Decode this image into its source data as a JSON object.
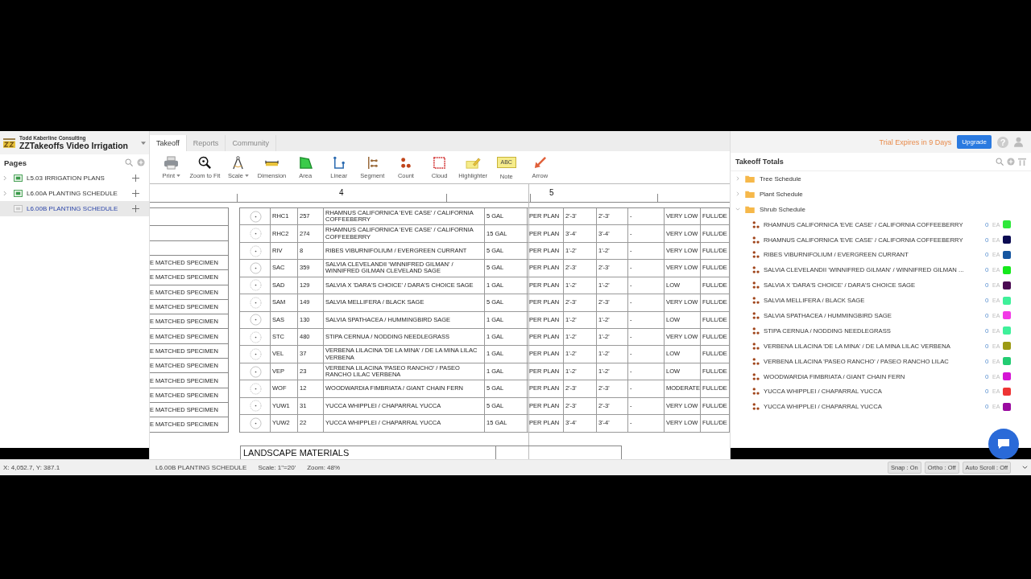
{
  "app": {
    "company": "Todd Kaberline Consulting",
    "project": "ZZTakeoffs Video Irrigation"
  },
  "pages": {
    "title": "Pages",
    "items": [
      {
        "label": "L5.03 IRRIGATION PLANS",
        "selected": false
      },
      {
        "label": "L6.00A PLANTING SCHEDULE",
        "selected": false
      },
      {
        "label": "L6.00B PLANTING SCHEDULE",
        "selected": true
      }
    ]
  },
  "tabs": [
    {
      "label": "Takeoff",
      "selected": true
    },
    {
      "label": "Reports",
      "selected": false
    },
    {
      "label": "Community",
      "selected": false
    }
  ],
  "toolbar": [
    {
      "label": "Print",
      "kind": "print",
      "dropdown": true
    },
    {
      "label": "Zoom to Fit",
      "kind": "zoom",
      "dropdown": false
    },
    {
      "label": "Scale",
      "kind": "scale",
      "dropdown": true
    },
    {
      "label": "Dimension",
      "kind": "dimension",
      "dropdown": false
    },
    {
      "label": "Area",
      "kind": "area",
      "dropdown": false
    },
    {
      "label": "Linear",
      "kind": "linear",
      "dropdown": false
    },
    {
      "label": "Segment",
      "kind": "segment",
      "dropdown": false
    },
    {
      "label": "Count",
      "kind": "count",
      "dropdown": false
    },
    {
      "label": "Cloud",
      "kind": "cloud",
      "dropdown": false
    },
    {
      "label": "Highlighter",
      "kind": "highlighter",
      "dropdown": false
    },
    {
      "label": "Note",
      "kind": "note",
      "dropdown": false,
      "icon_text": "ABC"
    },
    {
      "label": "Arrow",
      "kind": "arrow",
      "dropdown": false
    }
  ],
  "drawing": {
    "grid_labels": [
      "4",
      "5"
    ],
    "left_column": [
      "E MATCHED SPECIMEN",
      "E MATCHED SPECIMEN",
      "E MATCHED SPECIMEN",
      "E MATCHED SPECIMEN",
      "E MATCHED SPECIMEN",
      "E MATCHED SPECIMEN",
      "E MATCHED SPECIMEN",
      "E MATCHED SPECIMEN",
      "E MATCHED SPECIMEN",
      "E MATCHED SPECIMEN",
      "E MATCHED SPECIMEN",
      "E MATCHED SPECIMEN"
    ],
    "schedule_rows": [
      [
        "RHC1",
        "257",
        "RHAMNUS CALIFORNICA 'EVE CASE' / CALIFORNIA COFFEEBERRY",
        "5 GAL",
        "PER PLAN",
        "2'-3'",
        "2'-3'",
        "-",
        "VERY LOW",
        "FULL/DE"
      ],
      [
        "RHC2",
        "274",
        "RHAMNUS CALIFORNICA 'EVE CASE' / CALIFORNIA COFFEEBERRY",
        "15 GAL",
        "PER PLAN",
        "3'-4'",
        "3'-4'",
        "-",
        "VERY LOW",
        "FULL/DE"
      ],
      [
        "RIV",
        "8",
        "RIBES VIBURNIFOLIUM / EVERGREEN CURRANT",
        "5 GAL",
        "PER PLAN",
        "1'-2'",
        "1'-2'",
        "-",
        "VERY LOW",
        "FULL/DE"
      ],
      [
        "SAC",
        "359",
        "SALVIA CLEVELANDII 'WINNIFRED GILMAN' / WINNIFRED GILMAN CLEVELAND SAGE",
        "5 GAL",
        "PER PLAN",
        "2'-3'",
        "2'-3'",
        "-",
        "VERY LOW",
        "FULL/DE"
      ],
      [
        "SAD",
        "129",
        "SALVIA X 'DARA'S CHOICE' / DARA'S CHOICE SAGE",
        "1 GAL",
        "PER PLAN",
        "1'-2'",
        "1'-2'",
        "-",
        "LOW",
        "FULL/DE"
      ],
      [
        "SAM",
        "149",
        "SALVIA MELLIFERA / BLACK SAGE",
        "5 GAL",
        "PER PLAN",
        "2'-3'",
        "2'-3'",
        "-",
        "VERY LOW",
        "FULL/DE"
      ],
      [
        "SAS",
        "130",
        "SALVIA SPATHACEA / HUMMINGBIRD SAGE",
        "1 GAL",
        "PER PLAN",
        "1'-2'",
        "1'-2'",
        "-",
        "LOW",
        "FULL/DE"
      ],
      [
        "STC",
        "480",
        "STIPA CERNUA / NODDING NEEDLEGRASS",
        "1 GAL",
        "PER PLAN",
        "1'-2'",
        "1'-2'",
        "-",
        "VERY LOW",
        "FULL/DE"
      ],
      [
        "VEL",
        "37",
        "VERBENA LILACINA 'DE LA MINA' / DE LA MINA LILAC VERBENA",
        "1 GAL",
        "PER PLAN",
        "1'-2'",
        "1'-2'",
        "-",
        "LOW",
        "FULL/DE"
      ],
      [
        "VEP",
        "23",
        "VERBENA LILACINA 'PASEO RANCHO' / PASEO RANCHO LILAC VERBENA",
        "1 GAL",
        "PER PLAN",
        "1'-2'",
        "1'-2'",
        "-",
        "LOW",
        "FULL/DE"
      ],
      [
        "WOF",
        "12",
        "WOODWARDIA FIMBRIATA / GIANT CHAIN FERN",
        "5 GAL",
        "PER PLAN",
        "2'-3'",
        "2'-3'",
        "-",
        "MODERATE",
        "FULL/DE"
      ],
      [
        "YUW1",
        "31",
        "YUCCA WHIPPLEI / CHAPARRAL YUCCA",
        "5 GAL",
        "PER PLAN",
        "2'-3'",
        "2'-3'",
        "-",
        "VERY LOW",
        "FULL/DE"
      ],
      [
        "YUW2",
        "22",
        "YUCCA WHIPPLEI / CHAPARRAL YUCCA",
        "15 GAL",
        "PER PLAN",
        "3'-4'",
        "3'-4'",
        "-",
        "VERY LOW",
        "FULL/DE"
      ]
    ],
    "materials_title": "LANDSCAPE MATERIALS"
  },
  "top_bar": {
    "trial": "Trial Expires in 9 Days",
    "upgrade": "Upgrade",
    "help": "?"
  },
  "totals": {
    "title": "Takeoff Totals",
    "folders": [
      {
        "label": "Tree Schedule",
        "expanded": false
      },
      {
        "label": "Plant Schedule",
        "expanded": false
      },
      {
        "label": "Shrub Schedule",
        "expanded": true,
        "children": [
          {
            "name": "RHAMNUS CALIFORNICA 'EVE CASE' / CALIFORNIA COFFEEBERRY",
            "count": "0",
            "unit": "EA",
            "color": "#2ee83a"
          },
          {
            "name": "RHAMNUS CALIFORNICA 'EVE CASE' / CALIFORNIA COFFEEBERRY",
            "count": "0",
            "unit": "EA",
            "color": "#0b0b52"
          },
          {
            "name": "RIBES VIBURNIFOLIUM / EVERGREEN CURRANT",
            "count": "0",
            "unit": "EA",
            "color": "#1555a0"
          },
          {
            "name": "SALVIA CLEVELANDII 'WINNIFRED GILMAN' / WINNIFRED GILMAN ...",
            "count": "0",
            "unit": "EA",
            "color": "#14e81c"
          },
          {
            "name": "SALVIA X 'DARA'S CHOICE' / DARA'S CHOICE SAGE",
            "count": "0",
            "unit": "EA",
            "color": "#4a0a52"
          },
          {
            "name": "SALVIA MELLIFERA / BLACK SAGE",
            "count": "0",
            "unit": "EA",
            "color": "#3ff09a"
          },
          {
            "name": "SALVIA SPATHACEA / HUMMINGBIRD SAGE",
            "count": "0",
            "unit": "EA",
            "color": "#f23ae6"
          },
          {
            "name": "STIPA CERNUA / NODDING NEEDLEGRASS",
            "count": "0",
            "unit": "EA",
            "color": "#3ff09a"
          },
          {
            "name": "VERBENA LILACINA 'DE LA MINA' / DE LA MINA LILAC VERBENA",
            "count": "0",
            "unit": "EA",
            "color": "#9c9a14"
          },
          {
            "name": "VERBENA LILACINA 'PASEO RANCHO' / PASEO RANCHO LILAC",
            "count": "0",
            "unit": "EA",
            "color": "#22cc72"
          },
          {
            "name": "WOODWARDIA FIMBRIATA / GIANT CHAIN FERN",
            "count": "0",
            "unit": "EA",
            "color": "#d414d4"
          },
          {
            "name": "YUCCA WHIPPLEI / CHAPARRAL YUCCA",
            "count": "0",
            "unit": "EA",
            "color": "#ee3434"
          },
          {
            "name": "YUCCA WHIPPLEI / CHAPARRAL YUCCA",
            "count": "0",
            "unit": "EA",
            "color": "#9a0aa0"
          }
        ]
      }
    ]
  },
  "status_bar": {
    "coords": "X: 4,052.7, Y: 387.1",
    "page": "L6.00B PLANTING SCHEDULE",
    "scale": "Scale: 1\"=20'",
    "zoom": "Zoom: 48%",
    "toggles": [
      "Snap : On",
      "Ortho : Off",
      "Auto Scroll : Off"
    ]
  }
}
